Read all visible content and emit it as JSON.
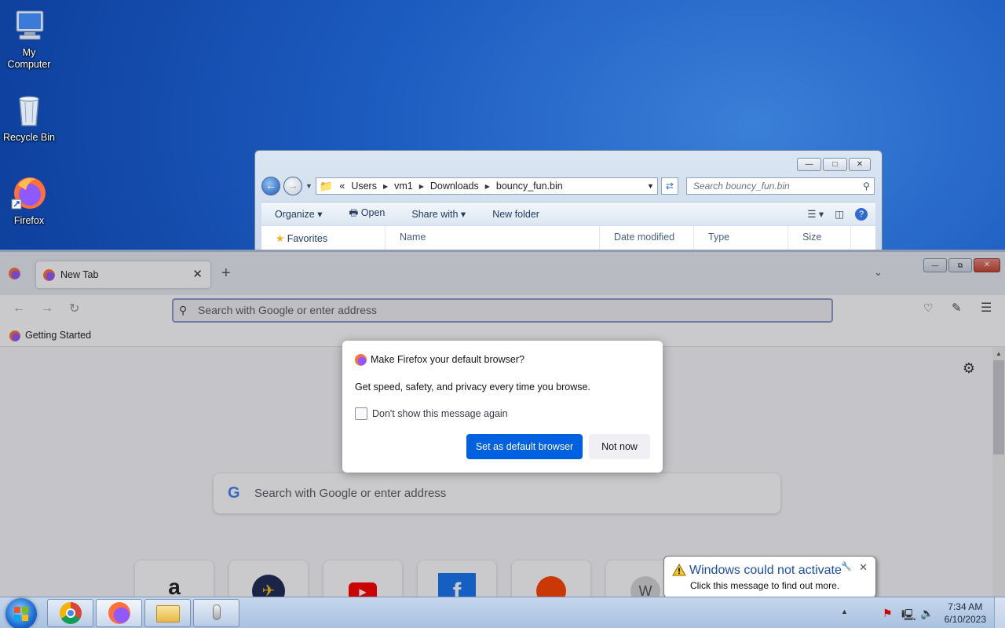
{
  "desktop": {
    "icons": [
      {
        "label": "My Computer",
        "icon": "computer-icon"
      },
      {
        "label": "Recycle Bin",
        "icon": "recycle-bin-icon"
      },
      {
        "label": "Firefox",
        "icon": "firefox-icon"
      }
    ]
  },
  "explorer": {
    "breadcrumb": [
      "«",
      "Users",
      "vm1",
      "Downloads",
      "bouncy_fun.bin"
    ],
    "search_placeholder": "Search bouncy_fun.bin",
    "toolbar": {
      "organize": "Organize",
      "open": "Open",
      "share_with": "Share with",
      "new_folder": "New folder"
    },
    "sidebar_favorites": "Favorites",
    "columns": [
      "Name",
      "Date modified",
      "Type",
      "Size"
    ]
  },
  "firefox": {
    "tab_title": "New Tab",
    "url_placeholder": "Search with Google or enter address",
    "bookmark": "Getting Started",
    "content_search_placeholder": "Search with Google or enter address",
    "top_sites": [
      "amazon",
      "expedia",
      "youtube",
      "facebook",
      "reddit",
      "wikipedia"
    ]
  },
  "dialog": {
    "title": "Make Firefox your default browser?",
    "description": "Get speed, safety, and privacy every time you browse.",
    "checkbox_label": "Don't show this message again",
    "primary_button": "Set as default browser",
    "secondary_button": "Not now"
  },
  "notification": {
    "title": "Windows could not activate",
    "body": "Click this message to find out more."
  },
  "taskbar": {
    "apps": [
      "chrome",
      "firefox",
      "file-explorer",
      "microphone"
    ],
    "time": "7:34 AM",
    "date": "6/10/2023"
  },
  "colors": {
    "primary_button": "#0061e0",
    "desktop_blue": "#1d5cc0",
    "notification_title": "#1b4fa3"
  }
}
